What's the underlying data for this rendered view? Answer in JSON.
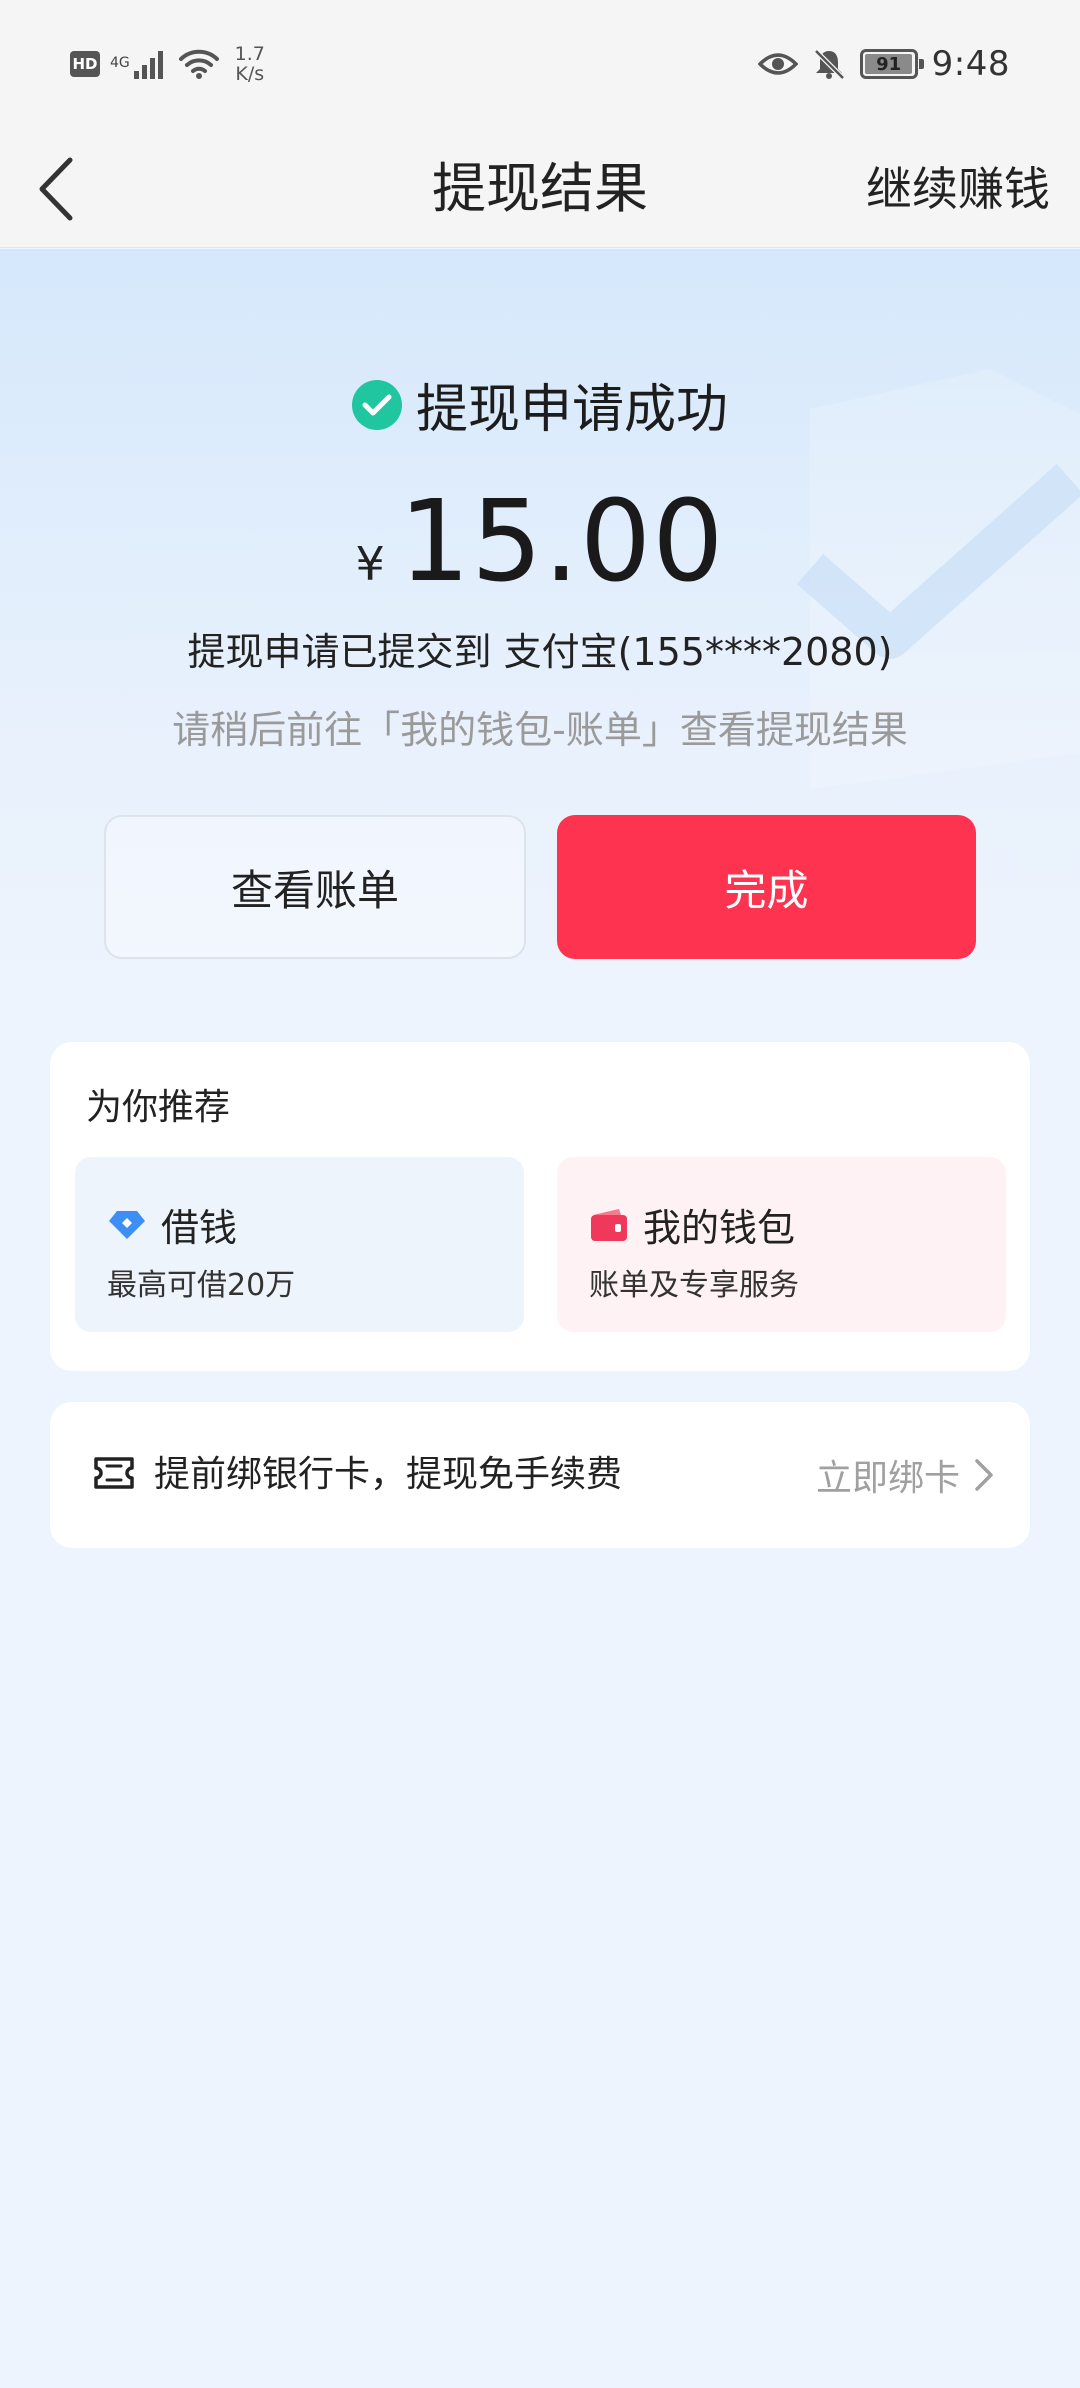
{
  "status_bar": {
    "hd_label": "HD",
    "network_label": "4G",
    "speed_value": "1.7",
    "speed_unit": "K/s",
    "battery_level": "91",
    "time": "9:48"
  },
  "nav": {
    "title": "提现结果",
    "action_label": "继续赚钱"
  },
  "result": {
    "status_text": "提现申请成功",
    "currency_symbol": "¥",
    "amount": "15.00",
    "submitted_text": "提现申请已提交到 支付宝(155****2080)",
    "hint_text": "请稍后前往「我的钱包-账单」查看提现结果"
  },
  "buttons": {
    "view_bill_label": "查看账单",
    "done_label": "完成"
  },
  "recommend": {
    "title": "为你推荐",
    "items": [
      {
        "name": "借钱",
        "desc": "最高可借20万",
        "icon": "diamond-icon"
      },
      {
        "name": "我的钱包",
        "desc": "账单及专享服务",
        "icon": "wallet-icon"
      }
    ]
  },
  "bind_card": {
    "text": "提前绑银行卡，提现免手续费",
    "action_label": "立即绑卡"
  },
  "colors": {
    "accent_red": "#fe3350",
    "success_green": "#1fc6a0",
    "loan_blue": "#3d8ef5",
    "wallet_red": "#f0395a"
  }
}
